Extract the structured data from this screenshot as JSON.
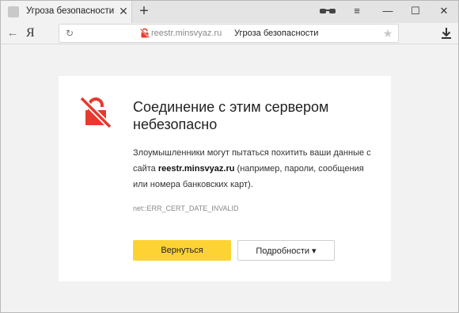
{
  "tab": {
    "title": "Угроза безопасности",
    "close_glyph": "✕"
  },
  "tabstrip": {
    "new_tab_glyph": "+"
  },
  "window_controls": {
    "menu_glyph": "≡",
    "minimize_glyph": "—",
    "maximize_glyph": "☐",
    "close_glyph": "✕"
  },
  "toolbar": {
    "back_glyph": "←",
    "logo": "Я"
  },
  "address": {
    "reload_glyph": "↻",
    "domain": "reestr.minsvyaz.ru",
    "page_title": "Угроза безопасности",
    "star_glyph": "★"
  },
  "error_page": {
    "heading_line1": "Соединение с этим сервером",
    "heading_line2": "небезопасно",
    "desc_before": "Злоумышленники могут пытаться похитить ваши данные с сайта ",
    "desc_domain": "reestr.minsvyaz.ru",
    "desc_after": " (например, пароли, сообщения или номера банковских карт).",
    "error_code": "net::ERR_CERT_DATE_INVALID",
    "back_button": "Вернуться",
    "details_button": "Подробности ▾"
  },
  "colors": {
    "warning_red": "#e63a2e",
    "primary_button": "#fdd334"
  },
  "icons": {
    "incognito": "glasses-icon",
    "warning": "broken-lock-icon",
    "download": "download-icon"
  }
}
